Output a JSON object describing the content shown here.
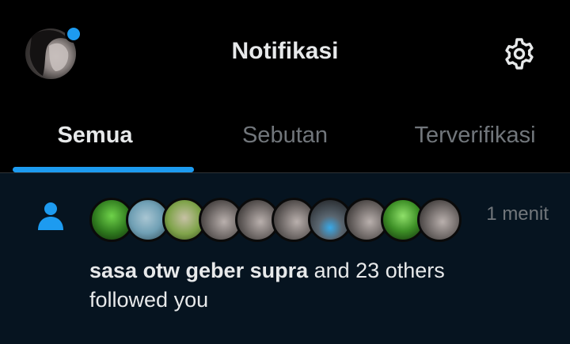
{
  "header": {
    "title": "Notifikasi",
    "avatar_icon": "profile-avatar",
    "settings_icon": "gear-icon",
    "unread_dot_color": "#1d9bf0"
  },
  "tabs": [
    {
      "label": "Semua",
      "active": true
    },
    {
      "label": "Sebutan",
      "active": false
    },
    {
      "label": "Terverifikasi",
      "active": false
    }
  ],
  "notification": {
    "type_icon": "person-icon",
    "time": "1 menit",
    "actor_name": "sasa otw geber supra",
    "rest_line1": " and 23 others",
    "rest_line2": "followed you",
    "avatar_count": 10
  },
  "colors": {
    "accent": "#1d9bf0",
    "background": "#000000",
    "notification_bg": "#061420",
    "text_primary": "#e7e9ea",
    "text_secondary": "#71767b"
  }
}
